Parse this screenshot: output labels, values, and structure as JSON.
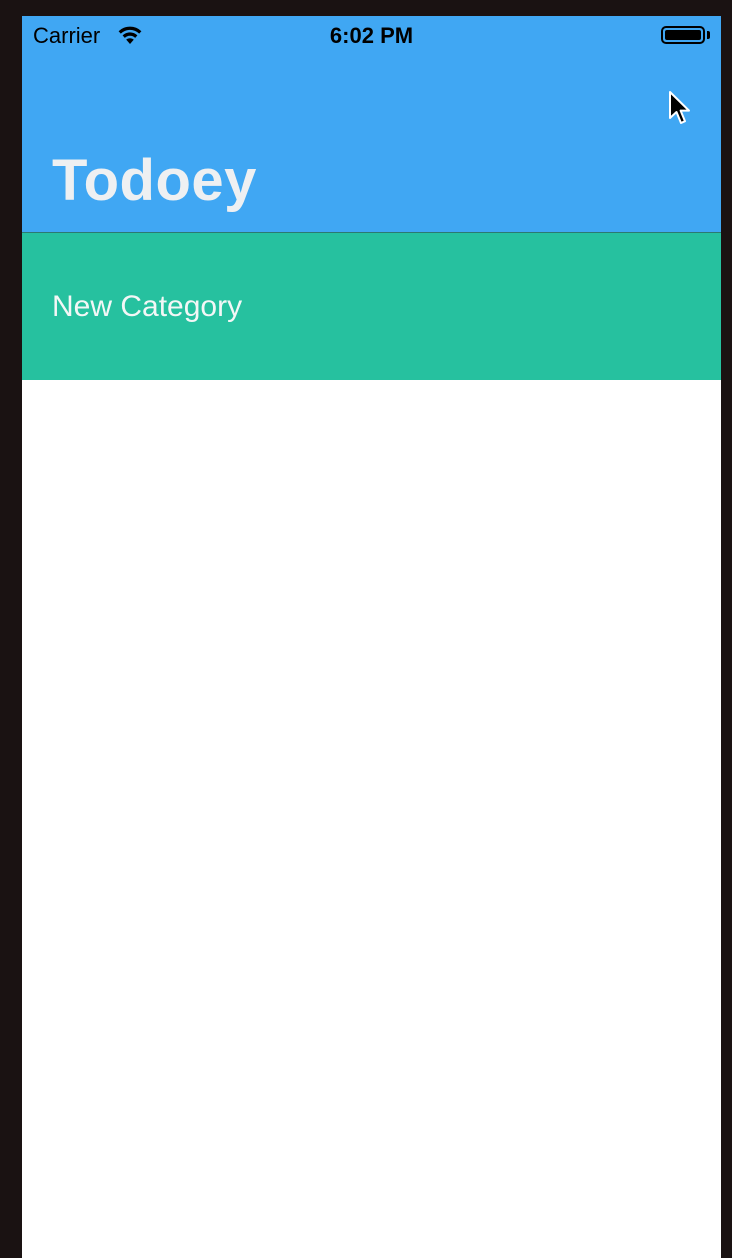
{
  "status_bar": {
    "carrier": "Carrier",
    "time": "6:02 PM",
    "wifi_icon": "wifi-icon",
    "battery_icon": "battery-icon"
  },
  "nav": {
    "title": "Todoey",
    "color": "#40a7f3"
  },
  "categories": [
    {
      "name": "New Category",
      "color": "#26c19f"
    }
  ],
  "cursor_icon": "mouse-pointer-icon"
}
